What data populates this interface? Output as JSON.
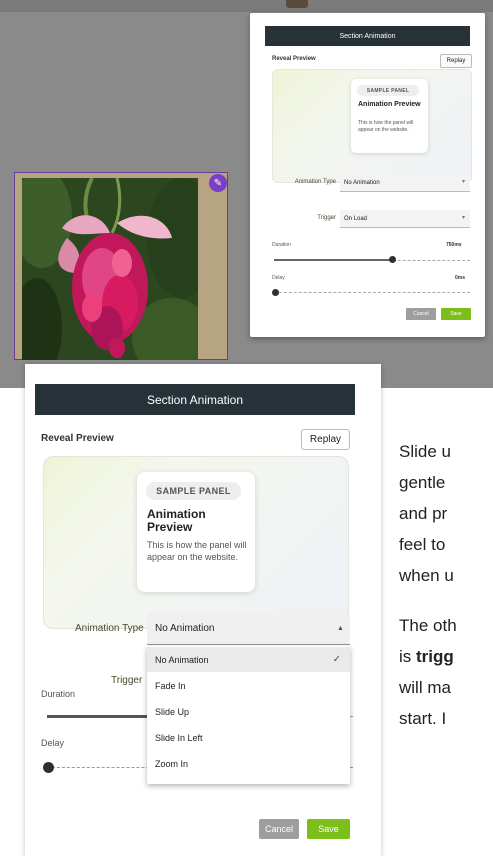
{
  "top_dialog": {
    "title": "Section Animation",
    "reveal_preview_label": "Reveal Preview",
    "replay_label": "Replay",
    "preview_card": {
      "pill": "SAMPLE PANEL",
      "title": "Animation Preview",
      "description": "This is how the panel will appear on the website."
    },
    "animation_type_label": "Animation Type",
    "animation_type_value": "No Animation",
    "trigger_label": "Trigger",
    "trigger_value": "On Load",
    "duration_label": "Duration",
    "duration_value": "750ms",
    "duration_fraction": 0.6,
    "delay_label": "Delay",
    "delay_value": "0ms",
    "delay_fraction": 0,
    "cancel_label": "Cancel",
    "save_label": "Save"
  },
  "main_dialog": {
    "title": "Section Animation",
    "reveal_preview_label": "Reveal Preview",
    "replay_label": "Replay",
    "preview_card": {
      "pill": "SAMPLE PANEL",
      "title": "Animation Preview",
      "description": "This is how the panel will appear on the website."
    },
    "animation_type_label": "Animation Type",
    "animation_type_value": "No Animation",
    "trigger_label": "Trigger",
    "duration_label": "Duration",
    "delay_label": "Delay",
    "delay_fraction": 0,
    "menu_options": [
      "No Animation",
      "Fade In",
      "Slide Up",
      "Slide In Left",
      "Zoom In"
    ],
    "selected_option": "No Animation",
    "cancel_label": "Cancel",
    "save_label": "Save"
  },
  "body_text": {
    "line1": "Slide u",
    "line2": "gentle",
    "line3": "and pr",
    "line4": "feel to",
    "line5": "when u",
    "line6": "The oth",
    "line7_prefix": "is ",
    "line7_bold": "trigg",
    "line8": "will ma",
    "line9": "start.  I"
  },
  "colors": {
    "header_bg": "#263238",
    "save_green": "#7cbf1a",
    "cancel_grey": "#9e9e9e",
    "edit_purple": "#7a3fc4"
  },
  "icons": {
    "edit": "pencil-icon",
    "caret": "caret-icon",
    "check": "check-icon"
  }
}
